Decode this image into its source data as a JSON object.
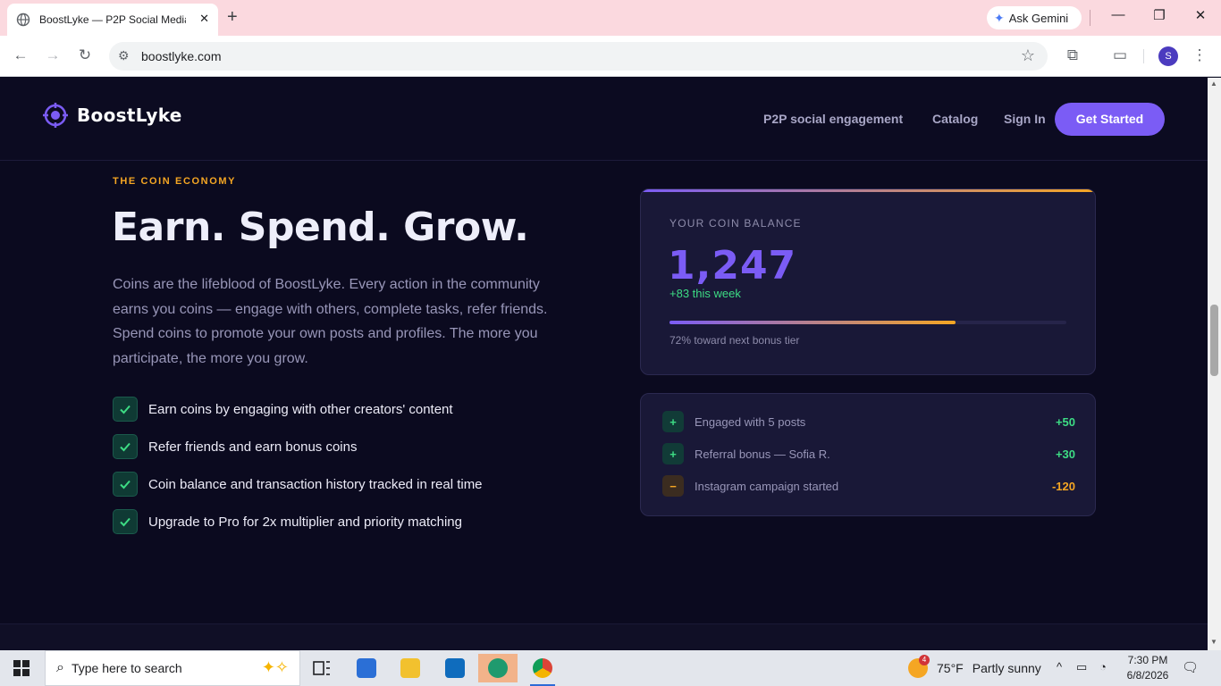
{
  "browser": {
    "tab_title": "BoostLyke — P2P Social Media ",
    "tab_close": "✕",
    "new_tab": "+",
    "ask_gemini": "Ask Gemini",
    "url": "boostlyke.com",
    "profile_initial": "S",
    "window_controls": {
      "minimize": "—",
      "restore": "❐",
      "close": "✕"
    }
  },
  "nav": {
    "brand": "BoostLyke",
    "links": [
      "P2P social engagement",
      "Catalog",
      "Sign In"
    ],
    "cta": "Get Started"
  },
  "hero": {
    "eyebrow": "THE COIN ECONOMY",
    "headline": "Earn. Spend. Grow.",
    "lead": "Coins are the lifeblood of BoostLyke. Every action in the community earns you coins — engage with others, complete tasks, refer friends. Spend coins to promote your own posts and profiles. The more you participate, the more you grow.",
    "features": [
      "Earn coins by engaging with other creators' content",
      "Refer friends and earn bonus coins",
      "Coin balance and transaction history tracked in real time",
      "Upgrade to Pro for 2x multiplier and priority matching"
    ]
  },
  "balance": {
    "label": "YOUR COIN BALANCE",
    "value": "1,247",
    "week": "+83 this week",
    "progress_fraction": 0.72,
    "progress_text": "72% toward next bonus tier"
  },
  "transactions": [
    {
      "sign": "+",
      "label": "Engaged with 5 posts",
      "amount": "+50",
      "type": "credit"
    },
    {
      "sign": "+",
      "label": "Referral bonus — Sofia R.",
      "amount": "+30",
      "type": "credit"
    },
    {
      "sign": "−",
      "label": "Instagram campaign started",
      "amount": "-120",
      "type": "debit"
    }
  ],
  "colors": {
    "accent": "#7b5cf5",
    "gold": "#f5a623",
    "credit": "#3ddc84",
    "debit": "#f5a623"
  },
  "taskbar": {
    "search_placeholder": "Type here to search",
    "weather_temp": "75°F",
    "weather_text": "Partly sunny",
    "weather_badge": "4",
    "time": "7:30 PM",
    "date": "6/8/2026",
    "apps": [
      "task-view",
      "microsoft-store",
      "file-explorer",
      "outlook",
      "edge",
      "chrome"
    ]
  }
}
